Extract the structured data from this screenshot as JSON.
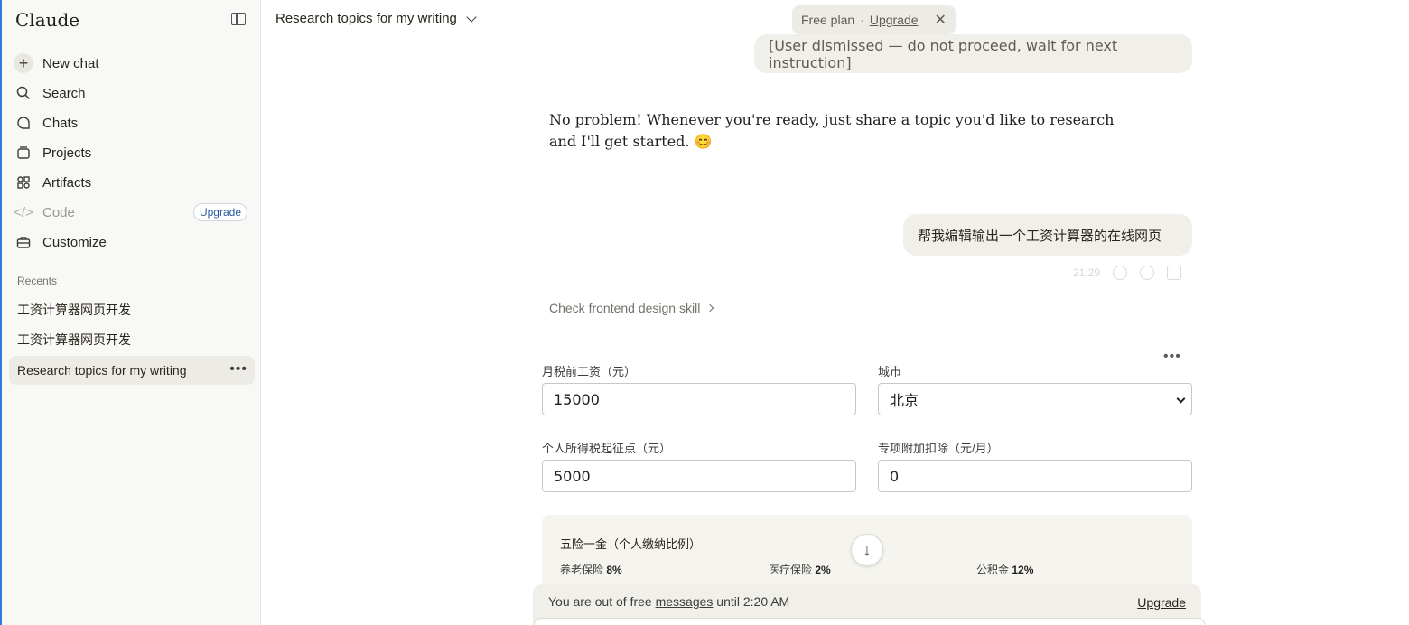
{
  "sidebar": {
    "brand": "Claude",
    "nav": [
      {
        "label": "New chat",
        "icon": "plus-icon"
      },
      {
        "label": "Search",
        "icon": "search-icon"
      },
      {
        "label": "Chats",
        "icon": "chat-bubble-icon"
      },
      {
        "label": "Projects",
        "icon": "folder-icon"
      },
      {
        "label": "Artifacts",
        "icon": "artifacts-icon"
      },
      {
        "label": "Code",
        "icon": "code-icon",
        "badge": "Upgrade"
      },
      {
        "label": "Customize",
        "icon": "briefcase-icon"
      }
    ],
    "recents_label": "Recents",
    "recents": [
      "工资计算器网页开发",
      "工资计算器网页开发",
      "Research topics for my writing"
    ]
  },
  "header": {
    "chat_title": "Research topics for my writing",
    "plan_label": "Free plan",
    "plan_separator": "·",
    "plan_upgrade": "Upgrade"
  },
  "messages": {
    "user_1": "[User dismissed — do not proceed, wait for next instruction]",
    "assistant_1": "No problem! Whenever you're ready, just share a topic you'd like to research and I'll get started. 😊",
    "user_2": "帮我编辑输出一个工资计算器的在线网页",
    "user_2_time": "21:29",
    "skill_link": "Check frontend design skill"
  },
  "artifact": {
    "salary_label": "月税前工资（元）",
    "salary_value": "15000",
    "city_label": "城市",
    "city_value": "北京",
    "threshold_label": "个人所得税起征点（元）",
    "threshold_value": "5000",
    "deduction_label": "专项附加扣除（元/月）",
    "deduction_value": "0",
    "insurance_title": "五险一金（个人缴纳比例）",
    "insurance_items": [
      {
        "label": "养老保险",
        "value": "8%"
      },
      {
        "label": "医疗保险",
        "value": "2%"
      },
      {
        "label": "公积金",
        "value": "12%"
      }
    ]
  },
  "limit": {
    "text_prefix": "You are out of free ",
    "text_link": "messages",
    "text_suffix": " until 2:20 AM",
    "upgrade": "Upgrade"
  }
}
